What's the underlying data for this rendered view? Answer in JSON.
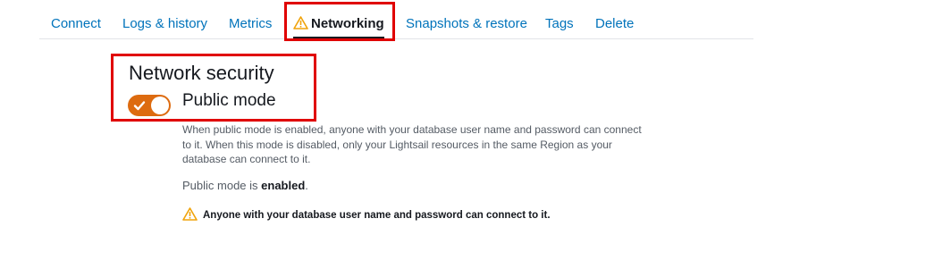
{
  "tabs": [
    {
      "label": "Connect"
    },
    {
      "label": "Logs & history"
    },
    {
      "label": "Metrics"
    },
    {
      "label": "Networking",
      "active": true,
      "icon": "warning-icon"
    },
    {
      "label": "Snapshots & restore"
    },
    {
      "label": "Tags"
    },
    {
      "label": "Delete"
    }
  ],
  "network_security": {
    "title": "Network security",
    "public_mode": {
      "label": "Public mode",
      "enabled": true,
      "description": "When public mode is enabled, anyone with your database user name and password can connect to it. When this mode is disabled, only your Lightsail resources in the same Region as your database can connect to it.",
      "status_prefix": "Public mode is ",
      "status_value": "enabled",
      "status_suffix": ".",
      "warning": "Anyone with your database user name and password can connect to it."
    }
  },
  "colors": {
    "link": "#0073bb",
    "toggle_on": "#dd6b10",
    "warning": "#f0a30a",
    "highlight": "#e00000"
  }
}
